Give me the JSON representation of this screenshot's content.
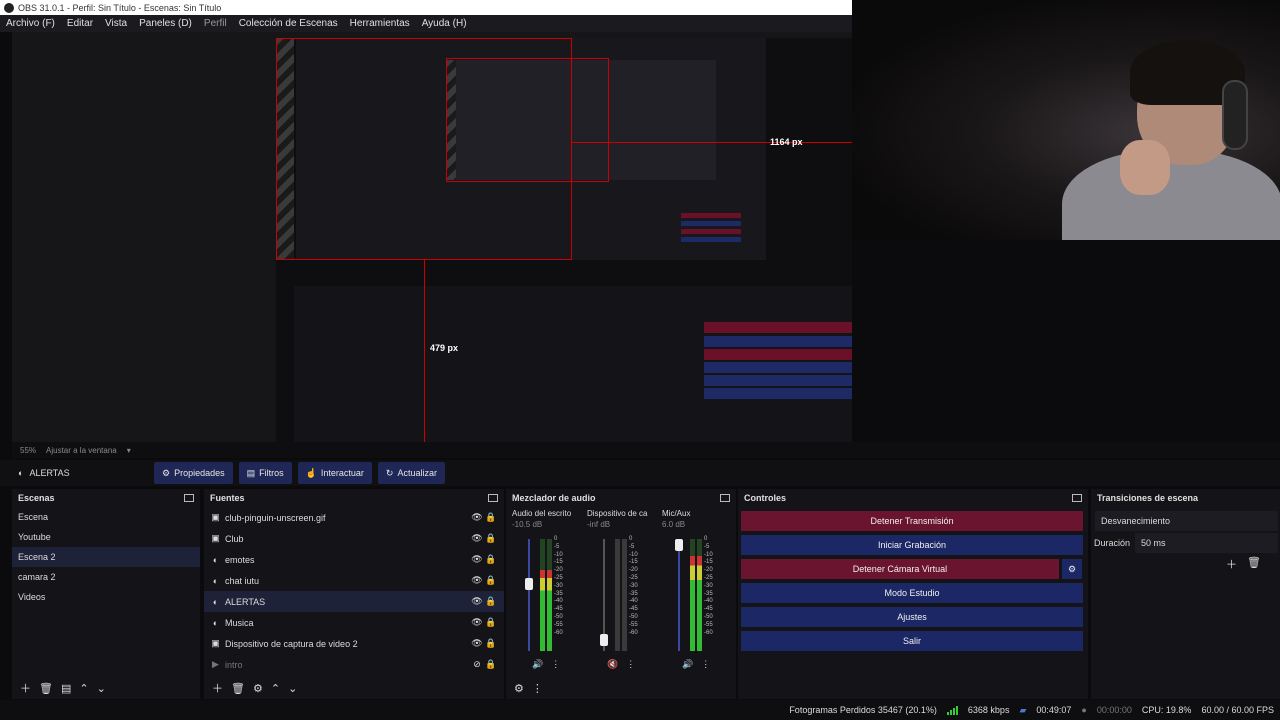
{
  "window": {
    "title": "OBS 31.0.1 - Perfil: Sin Título - Escenas: Sin Título"
  },
  "menu": [
    {
      "label": "Archivo (F)",
      "dim": false
    },
    {
      "label": "Editar",
      "dim": false
    },
    {
      "label": "Vista",
      "dim": false
    },
    {
      "label": "Paneles (D)",
      "dim": false
    },
    {
      "label": "Perfil",
      "dim": true
    },
    {
      "label": "Colección de Escenas",
      "dim": false
    },
    {
      "label": "Herramientas",
      "dim": false
    },
    {
      "label": "Ayuda (H)",
      "dim": false
    }
  ],
  "preview": {
    "dimension_label_h": "1164 px",
    "dimension_label_v": "479 px",
    "zoom": "55%",
    "zoom_mode": "Ajustar a la ventana"
  },
  "toolbar": {
    "source_name": "ALERTAS",
    "properties": "Propiedades",
    "filters": "Filtros",
    "interact": "Interactuar",
    "refresh": "Actualizar"
  },
  "scenes": {
    "title": "Escenas",
    "items": [
      "Escena",
      "Youtube",
      "Escena 2",
      "camara 2",
      "Videos"
    ],
    "selected": "Escena 2"
  },
  "sources": {
    "title": "Fuentes",
    "items": [
      {
        "name": "club-pinguin-unscreen.gif",
        "icon": "image-icon",
        "visible": true,
        "selected": false
      },
      {
        "name": "Club",
        "icon": "image-icon",
        "visible": true,
        "selected": false
      },
      {
        "name": "emotes",
        "icon": "browser-icon",
        "visible": true,
        "selected": false
      },
      {
        "name": "chat iutu",
        "icon": "browser-icon",
        "visible": true,
        "selected": false
      },
      {
        "name": "ALERTAS",
        "icon": "browser-icon",
        "visible": true,
        "selected": true
      },
      {
        "name": "Musica",
        "icon": "browser-icon",
        "visible": true,
        "selected": false
      },
      {
        "name": "Dispositivo de captura de video 2",
        "icon": "camera-icon",
        "visible": true,
        "selected": false
      },
      {
        "name": "intro",
        "icon": "play-icon",
        "visible": false,
        "selected": false
      }
    ]
  },
  "mixer": {
    "title": "Mezclador de audio",
    "channels": [
      {
        "name": "Audio del escrito",
        "db": "-10.5 dB",
        "level": 0.72,
        "fader": 0.6,
        "muted": false
      },
      {
        "name": "Dispositivo de ca",
        "db": "-inf dB",
        "level": 0.0,
        "fader": 0.1,
        "muted": true
      },
      {
        "name": "Mic/Aux",
        "db": "6.0 dB",
        "level": 0.85,
        "fader": 0.95,
        "muted": false
      }
    ],
    "scale": [
      "0",
      "-5",
      "-10",
      "-15",
      "-20",
      "-25",
      "-30",
      "-35",
      "-40",
      "-45",
      "-50",
      "-55",
      "-60"
    ]
  },
  "controls": {
    "title": "Controles",
    "buttons": [
      {
        "label": "Detener Transmisión",
        "style": "red"
      },
      {
        "label": "Iniciar Grabación",
        "style": "blue"
      },
      {
        "label": "Detener Cámara Virtual",
        "style": "red"
      },
      {
        "label": "Modo Estudio",
        "style": "blue"
      },
      {
        "label": "Ajustes",
        "style": "blue"
      },
      {
        "label": "Salir",
        "style": "blue"
      }
    ]
  },
  "transitions": {
    "title": "Transiciones de escena",
    "selected": "Desvanecimiento",
    "duration_label": "Duración",
    "duration_value": "50 ms"
  },
  "status": {
    "dropped": "Fotogramas Perdidos 35467 (20.1%)",
    "bitrate": "6368 kbps",
    "live_time": "00:49:07",
    "rec_time": "00:00:00",
    "cpu": "CPU: 19.8%",
    "fps": "60.00 / 60.00 FPS"
  },
  "colors": {
    "accent_blue": "#1c2766",
    "accent_red": "#6b1430",
    "selection_red": "#cc0000"
  }
}
